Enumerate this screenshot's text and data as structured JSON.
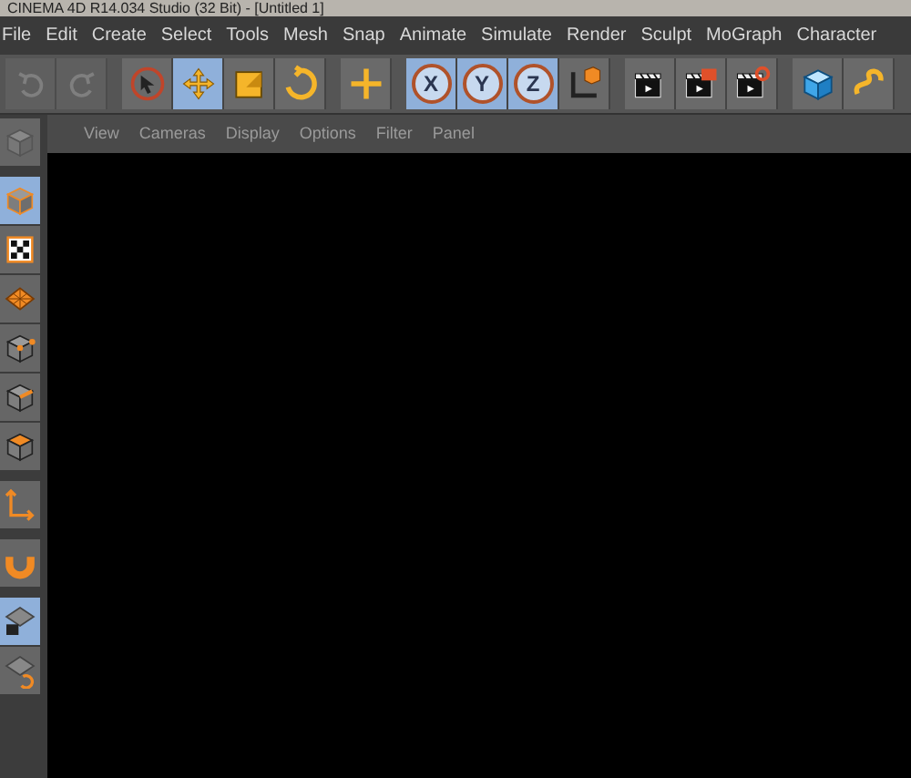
{
  "window": {
    "title": "CINEMA 4D R14.034 Studio (32 Bit) - [Untitled 1]"
  },
  "menu": [
    "File",
    "Edit",
    "Create",
    "Select",
    "Tools",
    "Mesh",
    "Snap",
    "Animate",
    "Simulate",
    "Render",
    "Sculpt",
    "MoGraph",
    "Character"
  ],
  "toolbar_groups": [
    [
      {
        "kind": "undo",
        "selected": false,
        "disabled": true
      },
      {
        "kind": "redo",
        "selected": false,
        "disabled": true
      }
    ],
    [
      {
        "kind": "select",
        "selected": false,
        "disabled": false
      },
      {
        "kind": "move",
        "selected": true,
        "disabled": false
      },
      {
        "kind": "scale",
        "selected": false,
        "disabled": false
      },
      {
        "kind": "rotate",
        "selected": false,
        "disabled": false
      }
    ],
    [
      {
        "kind": "add",
        "selected": false,
        "disabled": false
      }
    ],
    [
      {
        "kind": "axis",
        "label": "X",
        "selected": true,
        "disabled": false
      },
      {
        "kind": "axis",
        "label": "Y",
        "selected": true,
        "disabled": false
      },
      {
        "kind": "axis",
        "label": "Z",
        "selected": true,
        "disabled": false
      },
      {
        "kind": "coords",
        "selected": false,
        "disabled": false
      }
    ],
    [
      {
        "kind": "render-view",
        "selected": false,
        "disabled": false
      },
      {
        "kind": "render-picture",
        "selected": false,
        "disabled": false
      },
      {
        "kind": "render-settings",
        "selected": false,
        "disabled": false
      }
    ],
    [
      {
        "kind": "cube",
        "selected": false,
        "disabled": false
      },
      {
        "kind": "spline",
        "selected": false,
        "disabled": false
      }
    ]
  ],
  "viewport": {
    "menu": [
      "View",
      "Cameras",
      "Display",
      "Options",
      "Filter",
      "Panel"
    ]
  },
  "left_toolbar_groups": [
    [
      {
        "kind": "editable",
        "selected": false
      }
    ],
    [
      {
        "kind": "model",
        "selected": true
      },
      {
        "kind": "texture",
        "selected": false
      },
      {
        "kind": "workplane",
        "selected": false
      },
      {
        "kind": "points",
        "selected": false
      },
      {
        "kind": "edges",
        "selected": false
      },
      {
        "kind": "polygons",
        "selected": false
      }
    ],
    [
      {
        "kind": "axis",
        "selected": false
      }
    ],
    [
      {
        "kind": "magnet",
        "selected": false
      }
    ],
    [
      {
        "kind": "lock-plane",
        "selected": true
      },
      {
        "kind": "plane-rotate",
        "selected": false
      }
    ]
  ]
}
